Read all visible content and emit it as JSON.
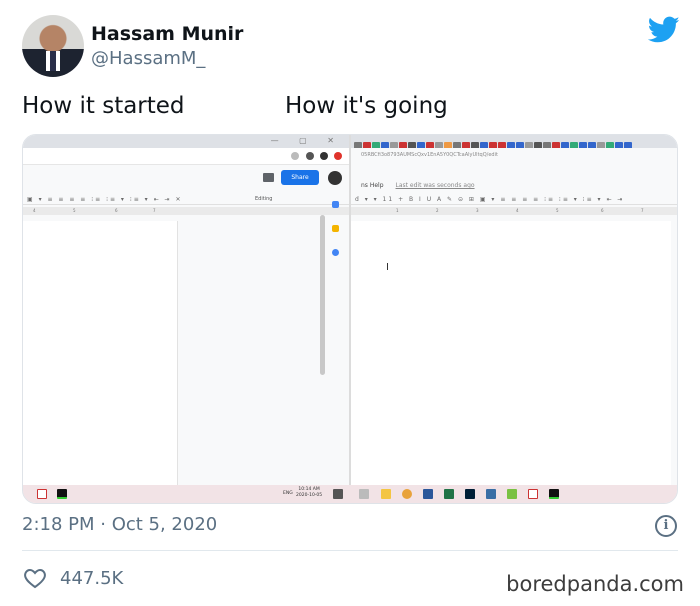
{
  "author": {
    "name": "Hassam Munir",
    "handle": "@HassamM_"
  },
  "captions": {
    "left": "How it started",
    "right": "How it's going"
  },
  "screenshot": {
    "share_label": "Share",
    "editing_label": "Editing",
    "menu_help": "ns Help",
    "last_edit": "Last edit was seconds ago",
    "url_fragment": "05RBCfi3o8793AUMScQxv1EnA5Y0QCTcaAlyUltqQ/edit",
    "taskbar_lang": "ENG",
    "taskbar_time": "10:14 AM",
    "taskbar_date": "2020-10-05"
  },
  "timestamp": "2:18 PM · Oct 5, 2020",
  "likes": "447.5K",
  "watermark": "boredpanda.com",
  "colors": {
    "twitter_blue": "#1da1f2",
    "share_blue": "#1a73e8",
    "taskbar_pink": "#f2e3e6"
  }
}
